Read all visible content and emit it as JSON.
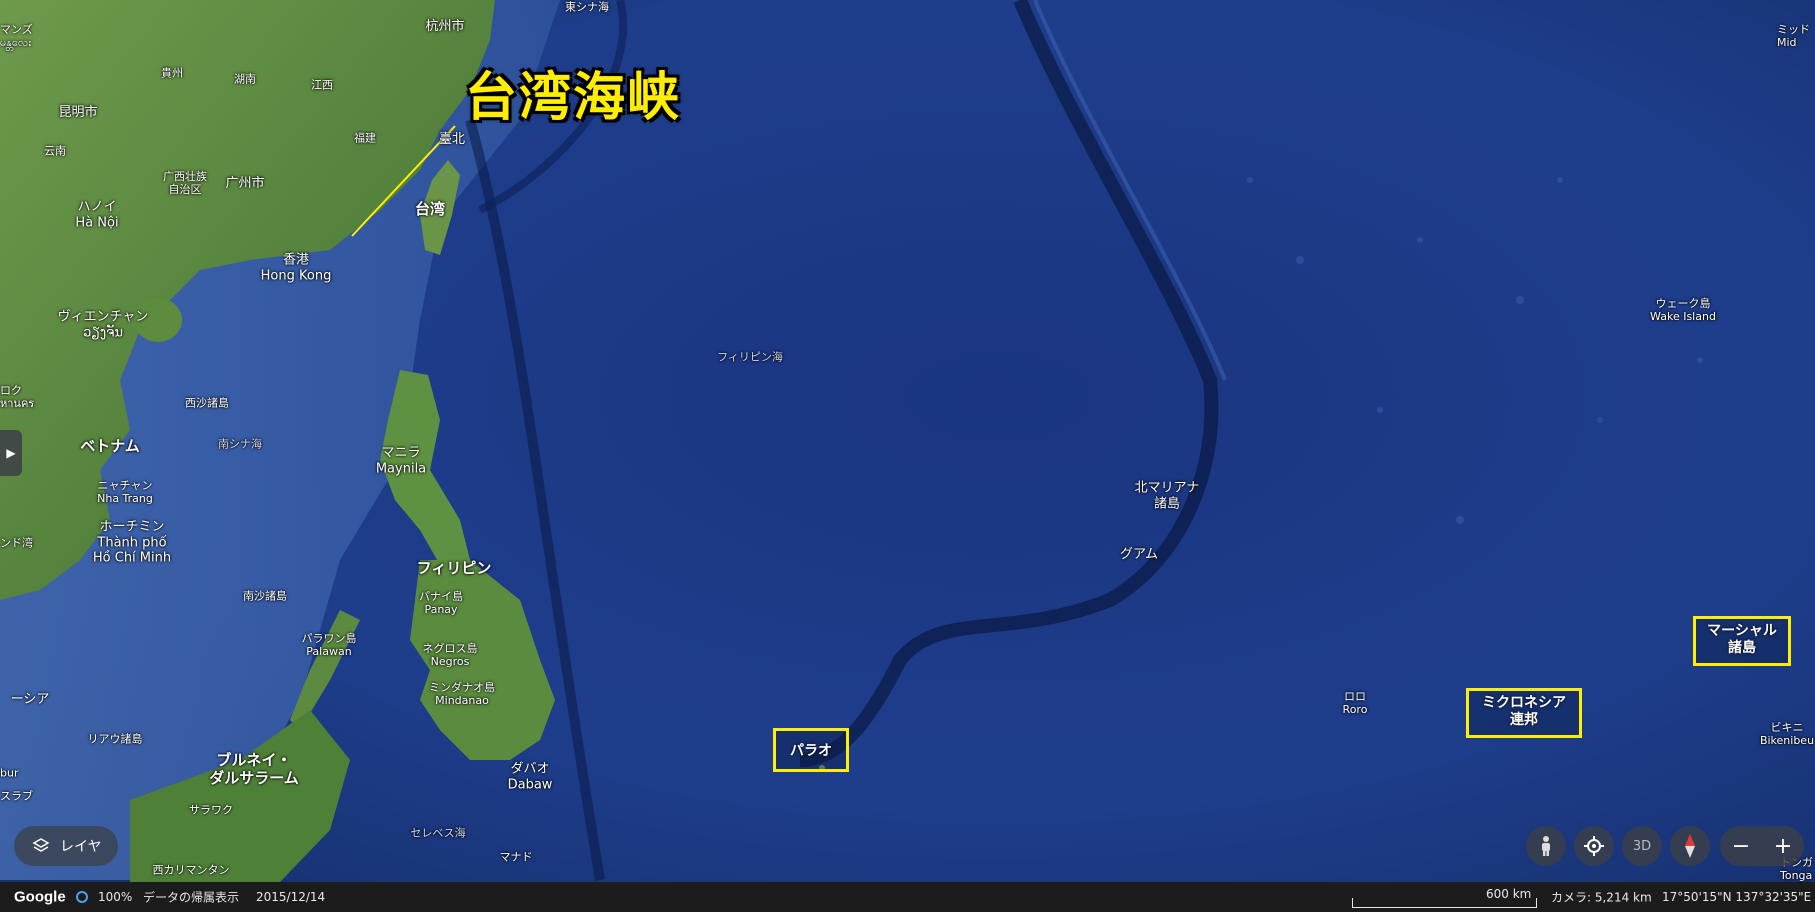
{
  "colors": {
    "highlight": "#ffee00",
    "ocean": "#1e3c8c",
    "land": "#5a8a3c",
    "bar": "#1c1c1c"
  },
  "annotation": {
    "title": "台湾海峡"
  },
  "boxed_labels": {
    "palau": "パラオ",
    "micronesia_1": "ミクロネシア",
    "micronesia_2": "連邦",
    "marshall_1": "マーシャル",
    "marshall_2": "諸島"
  },
  "labels": {
    "hangzhou": "杭州市",
    "east_china_sea": "東シナ海",
    "kunming": "昆明市",
    "guizhou": "貴州",
    "hunan": "湖南",
    "jiangxi": "江西",
    "fujian": "福建",
    "taipei": "臺北",
    "taiwan": "台湾",
    "yunnan": "云南",
    "guangxi_1": "广西壮族",
    "guangxi_2": "自治区",
    "guangzhou": "广州市",
    "hanoi_ja": "ハノイ",
    "hanoi": "Hà Nội",
    "hongkong_ja": "香港",
    "hongkong": "Hong Kong",
    "vientiane_ja": "ヴィエンチャン",
    "vientiane": "ວຽງຈັນ",
    "paracel": "西沙諸島",
    "south_china_sea": "南シナ海",
    "vietnam": "ベトナム",
    "nhatrang_ja": "ニャチャン",
    "nhatrang": "Nha Trang",
    "hcm_ja": "ホーチミン",
    "hcm_1": "Thành phố",
    "hcm_2": "Hồ Chí Minh",
    "manila_ja": "マニラ",
    "manila": "Maynila",
    "philippines": "フィリピン",
    "panay_ja": "パナイ島",
    "panay": "Panay",
    "negros_ja": "ネグロス島",
    "negros": "Negros",
    "mindanao_ja": "ミンダナオ島",
    "mindanao": "Mindanao",
    "palawan_ja": "パラワン島",
    "palawan": "Palawan",
    "spratly": "南沙諸島",
    "davao_ja": "ダバオ",
    "davao": "Dabaw",
    "brunei_1": "ブルネイ・",
    "brunei_2": "ダルサラーム",
    "sarawak": "サラワク",
    "celebes_sea": "セレベス海",
    "west_kalimantan": "西カリマンタン",
    "natuna": "リアウ諸島",
    "malaysia": "ーシア",
    "philippine_sea": "フィリピン海",
    "northern_mariana_1": "北マリアナ",
    "northern_mariana_2": "諸島",
    "guam": "グアム",
    "wake_ja": "ウェーク島",
    "wake": "Wake Island",
    "roro_ja": "ロロ",
    "roro": "Roro",
    "bikini_ja": "ビキニ",
    "bikini": "Bikenibeu",
    "midway_1": "ミッド",
    "midway_2": "Mid",
    "edge_1": "マンズ",
    "edge_2": "မန္တလေး",
    "edge_3": "ロク",
    "edge_4": "หานคร",
    "edge_5": "ンド湾",
    "edge_6": "bur",
    "edge_7": "スラブ",
    "manado": "マナド",
    "tonga": "トンガ",
    "tonga_en": "Tonga"
  },
  "controls": {
    "layers_label": "レイヤ",
    "three_d": "3D",
    "zoom_out": "−",
    "zoom_in": "+"
  },
  "bottombar": {
    "logo": "Google",
    "zoom": "100%",
    "data_attribution": "データの帰属表示",
    "date": "2015/12/14",
    "scale": "600 km",
    "camera": "カメラ: 5,214 km",
    "coords": "17°50'15\"N 137°32'35\"E"
  }
}
